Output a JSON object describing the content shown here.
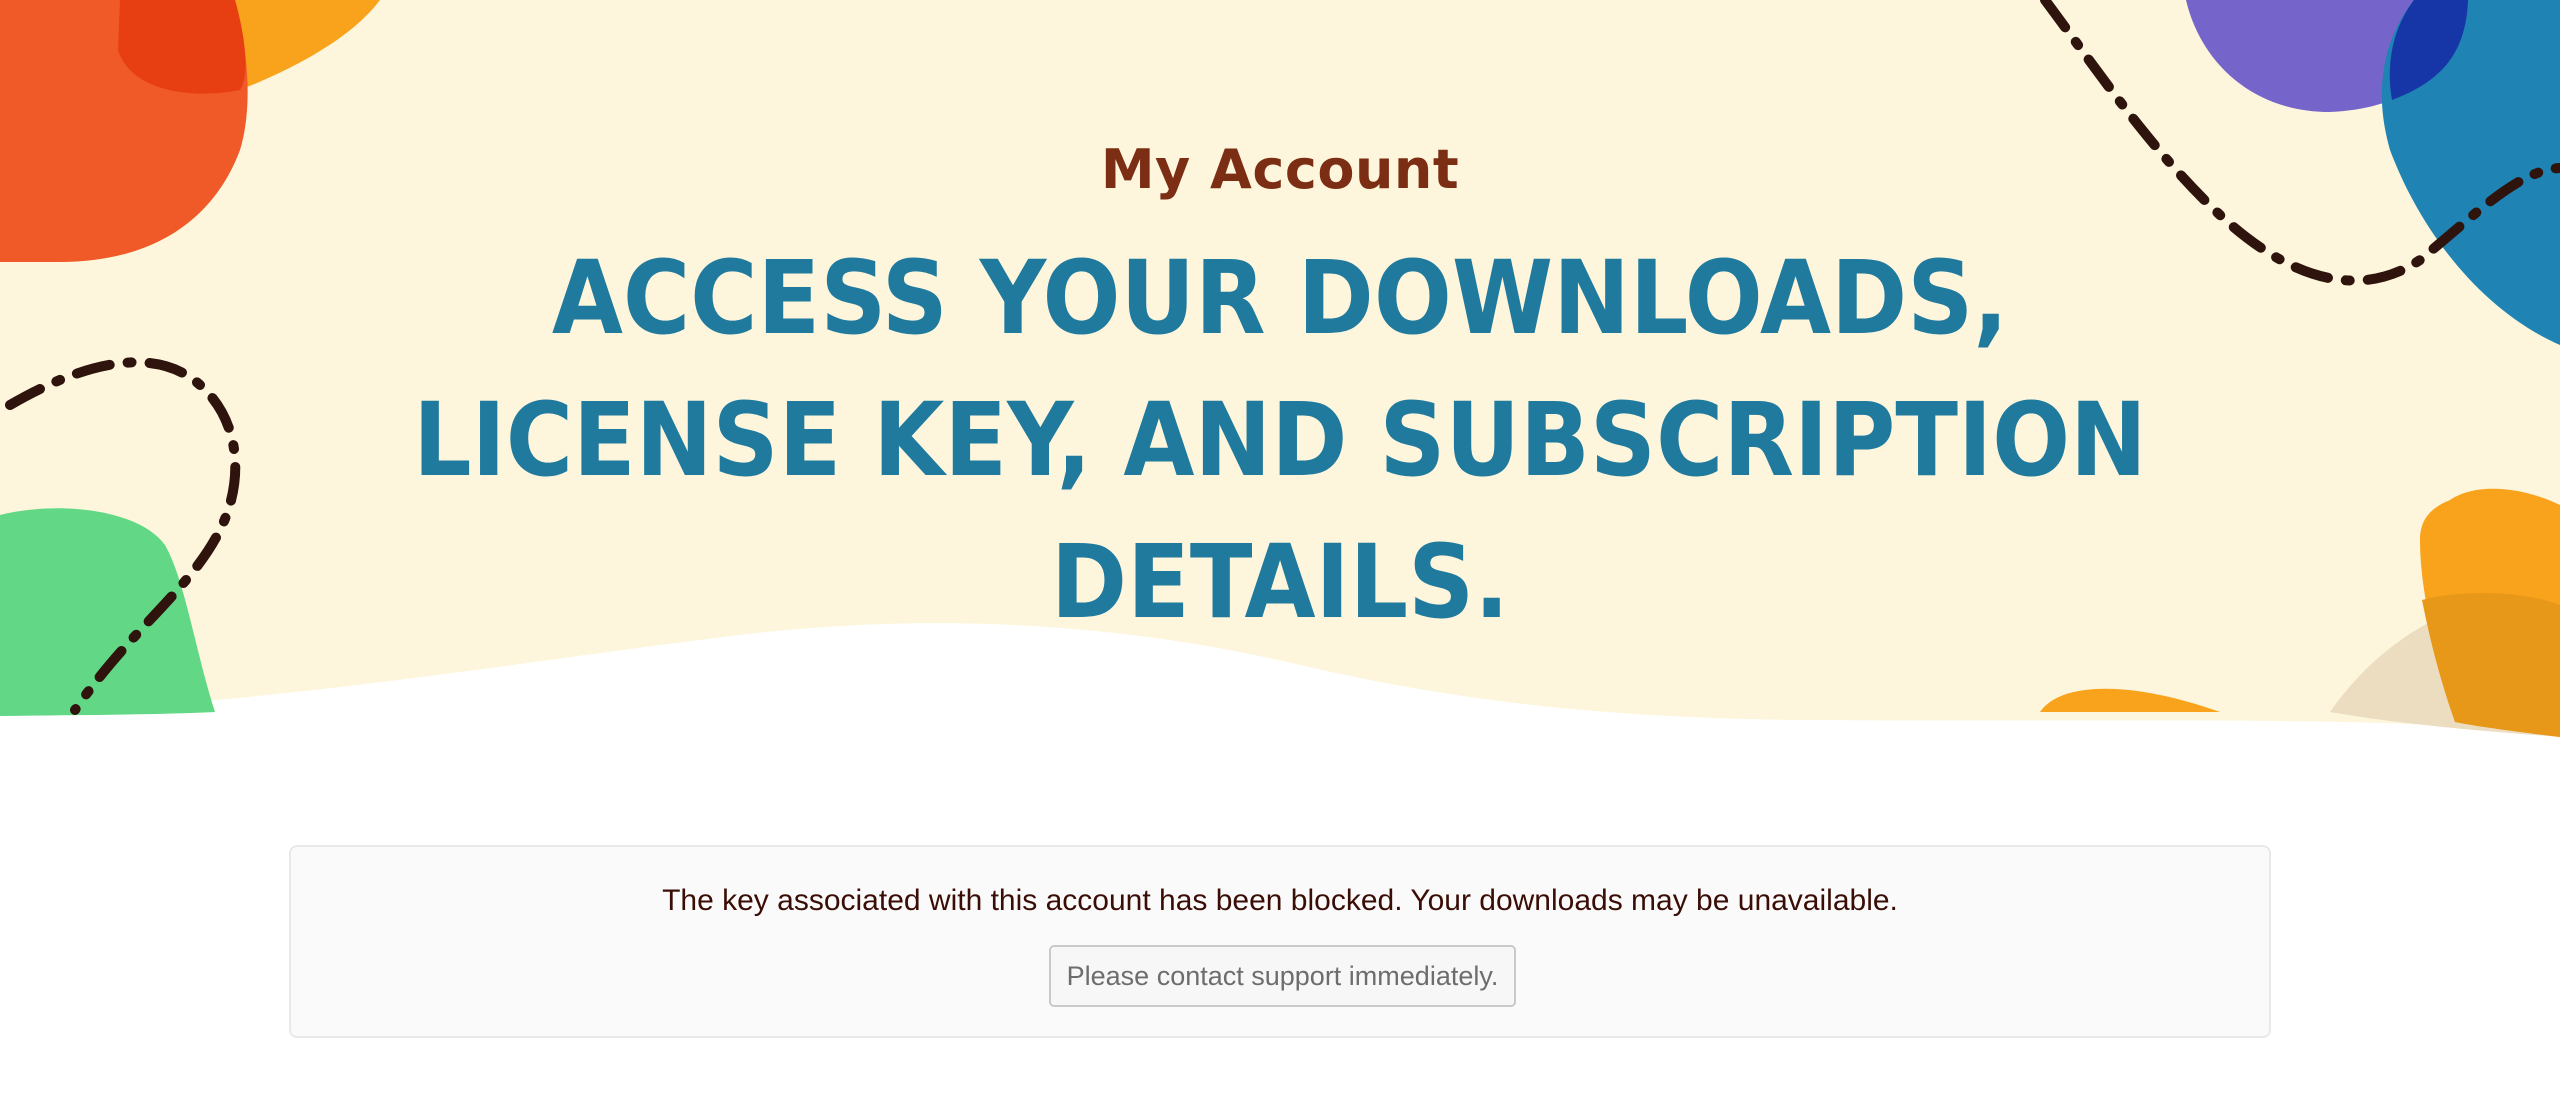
{
  "hero": {
    "eyebrow": "My Account",
    "headline": "ACCESS YOUR DOWNLOADS, LICENSE KEY, AND SUBSCRIPTION DETAILS."
  },
  "notice": {
    "message": "The key associated with this account has been blocked. Your downloads may be unavailable.",
    "button_label": "Please contact support immediately."
  },
  "colors": {
    "hero_background": "#fdf6dd",
    "eyebrow": "#7b2e14",
    "headline": "#1f7a9e",
    "notice_text": "#3a0e06",
    "blob_orange_red": "#ef5a28",
    "blob_orange": "#f9a21c",
    "blob_purple": "#7565cb",
    "blob_blue": "#1f83b4",
    "blob_green": "#62d886",
    "dash_line": "#2f130d"
  }
}
